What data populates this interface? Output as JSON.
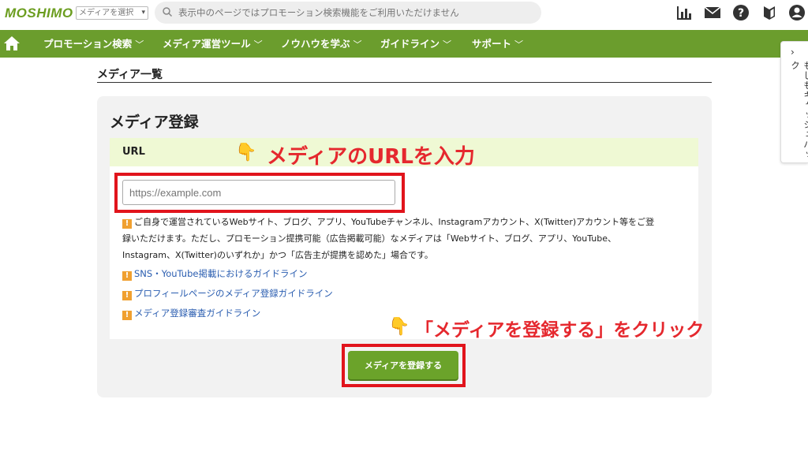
{
  "header": {
    "logo_text": "MOSHIMO",
    "media_select_value": "メディアを選択",
    "search_placeholder": "表示中のページではプロモーション検索機能をご利用いただけません",
    "icons": [
      "report-icon",
      "mail-icon",
      "help-icon",
      "beginner-icon",
      "user-icon"
    ]
  },
  "nav": {
    "items": [
      {
        "label": "プロモーション検索"
      },
      {
        "label": "メディア運営ツール"
      },
      {
        "label": "ノウハウを学ぶ"
      },
      {
        "label": "ガイドライン"
      },
      {
        "label": "サポート"
      }
    ],
    "chevron": "﹀"
  },
  "sidetab": {
    "label": "もしもキャッシュバック",
    "arrow": "›"
  },
  "page": {
    "title": "メディア一覧"
  },
  "form": {
    "title": "メディア登録",
    "url_label": "URL",
    "url_placeholder": "https://example.com",
    "note_lines": [
      "ご自身で運営されているWebサイト、ブログ、アプリ、YouTubeチャンネル、Instagramアカウント、X(Twitter)アカウント等をご登",
      "録いただけます。ただし、プロモーション提携可能（広告掲載可能）なメディアは「Webサイト、ブログ、アプリ、YouTube、",
      "Instagram、X(Twitter)のいずれか」かつ「広告主が提携を認めた」場合です。"
    ],
    "links": [
      {
        "label": "SNS・YouTube掲載におけるガイドライン"
      },
      {
        "label": "プロフィールページのメディア登録ガイドライン"
      },
      {
        "label": "メディア登録審査ガイドライン"
      }
    ],
    "submit_label": "メディアを登録する"
  },
  "annotations": {
    "input_hint": "メディアのURLを入力",
    "button_hint": "「メディアを登録する」をクリック",
    "hand_glyph": "👇",
    "highlight_color": "#e1141c"
  },
  "colors": {
    "brand_green": "#6b9d2d",
    "button_green": "#6ba32a",
    "link_blue": "#2a5db0",
    "annotation_red": "#e5282e"
  }
}
